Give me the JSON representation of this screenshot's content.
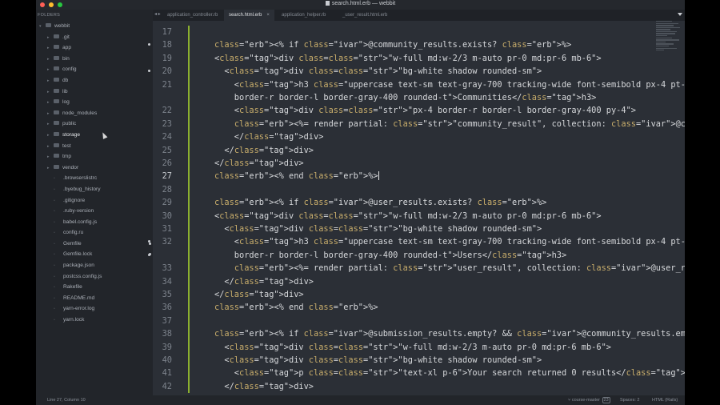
{
  "window": {
    "title": "search.html.erb — webbit"
  },
  "sidebar": {
    "header": "FOLDERS",
    "items": [
      {
        "label": "webbit",
        "type": "root",
        "open": true
      },
      {
        "label": ".git",
        "type": "folder"
      },
      {
        "label": "app",
        "type": "folder"
      },
      {
        "label": "bin",
        "type": "folder"
      },
      {
        "label": "config",
        "type": "folder"
      },
      {
        "label": "db",
        "type": "folder"
      },
      {
        "label": "lib",
        "type": "folder"
      },
      {
        "label": "log",
        "type": "folder"
      },
      {
        "label": "node_modules",
        "type": "folder"
      },
      {
        "label": "public",
        "type": "folder"
      },
      {
        "label": "storage",
        "type": "folder",
        "selected": true
      },
      {
        "label": "test",
        "type": "folder"
      },
      {
        "label": "tmp",
        "type": "folder"
      },
      {
        "label": "vendor",
        "type": "folder"
      },
      {
        "label": ".browserslistrc",
        "type": "file"
      },
      {
        "label": ".byebug_history",
        "type": "file"
      },
      {
        "label": ".gitignore",
        "type": "file"
      },
      {
        "label": ".ruby-version",
        "type": "file"
      },
      {
        "label": "babel.config.js",
        "type": "file"
      },
      {
        "label": "config.ru",
        "type": "file"
      },
      {
        "label": "Gemfile",
        "type": "file",
        "modified": true
      },
      {
        "label": "Gemfile.lock",
        "type": "file",
        "modified": true
      },
      {
        "label": "package.json",
        "type": "file"
      },
      {
        "label": "postcss.config.js",
        "type": "file"
      },
      {
        "label": "Rakefile",
        "type": "file"
      },
      {
        "label": "README.md",
        "type": "file"
      },
      {
        "label": "yarn-error.log",
        "type": "file"
      },
      {
        "label": "yarn.lock",
        "type": "file"
      }
    ]
  },
  "tabs": [
    {
      "label": "application_controller.rb",
      "active": false
    },
    {
      "label": "search.html.erb",
      "active": true,
      "close": "×"
    },
    {
      "label": "application_helper.rb",
      "active": false
    },
    {
      "label": "_user_result.html.erb",
      "active": false
    }
  ],
  "tabnav": "◂ ▸",
  "editor": {
    "lines": [
      {
        "n": "17",
        "text": ""
      },
      {
        "n": "18",
        "text": "<% if @community_results.exists? %>",
        "dot": true
      },
      {
        "n": "19",
        "text": "<div class=\"w-full md:w-2/3 m-auto pr-0 md:pr-6 mb-6\">"
      },
      {
        "n": "20",
        "text": "  <div class=\"bg-white shadow rounded-sm\">",
        "dot": true
      },
      {
        "n": "21",
        "text": "    <h3 class=\"uppercase text-sm text-gray-700 tracking-wide font-semibold px-4 pt-2 border-t"
      },
      {
        "n": "",
        "text": "    border-r border-l border-gray-400 rounded-t\">Communities</h3>"
      },
      {
        "n": "22",
        "text": "    <div class=\"px-4 border-r border-l border-gray-400 py-4\">"
      },
      {
        "n": "23",
        "text": "    <%= render partial: \"community_result\", collection: @community_results %>"
      },
      {
        "n": "24",
        "text": "    </div>"
      },
      {
        "n": "25",
        "text": "  </div>"
      },
      {
        "n": "26",
        "text": "</div>"
      },
      {
        "n": "27",
        "text": "<% end %>",
        "current": true
      },
      {
        "n": "28",
        "text": ""
      },
      {
        "n": "29",
        "text": "<% if @user_results.exists? %>"
      },
      {
        "n": "30",
        "text": "<div class=\"w-full md:w-2/3 m-auto pr-0 md:pr-6 mb-6\">"
      },
      {
        "n": "31",
        "text": "  <div class=\"bg-white shadow rounded-sm\">"
      },
      {
        "n": "32",
        "text": "    <h3 class=\"uppercase text-sm text-gray-700 tracking-wide font-semibold px-4 pt-2 border-t",
        "dot": true
      },
      {
        "n": "",
        "text": "    border-r border-l border-gray-400 rounded-t\">Users</h3>",
        "dot": true
      },
      {
        "n": "33",
        "text": "    <%= render partial: \"user_result\", collection: @user_results %>"
      },
      {
        "n": "34",
        "text": "  </div>"
      },
      {
        "n": "35",
        "text": "</div>"
      },
      {
        "n": "36",
        "text": "<% end %>"
      },
      {
        "n": "37",
        "text": ""
      },
      {
        "n": "38",
        "text": "<% if @submission_results.empty? && @community_results.empty? && @user_results.empty? %>"
      },
      {
        "n": "39",
        "text": "  <div class=\"w-full md:w-2/3 m-auto pr-0 md:pr-6 mb-6\">"
      },
      {
        "n": "40",
        "text": "  <div class=\"bg-white shadow rounded-sm\">"
      },
      {
        "n": "41",
        "text": "    <p class=\"text-xl p-6\">Your search returned 0 results</p>"
      },
      {
        "n": "42",
        "text": "  </div>"
      }
    ]
  },
  "status": {
    "position": "Line 27, Column 10",
    "branch": "course-master",
    "branch_count": "23",
    "spaces": "Spaces: 2",
    "syntax": "HTML (Rails)"
  },
  "colors": {
    "accent_modified": "#8bb02f",
    "background": "#2b2f36"
  }
}
